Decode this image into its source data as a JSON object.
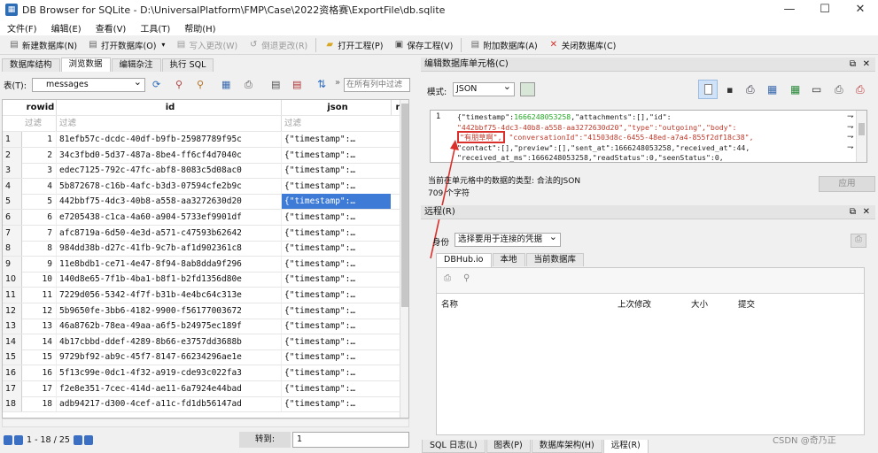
{
  "window": {
    "title": "DB Browser for SQLite - D:\\UniversalPlatform\\FMP\\Case\\2022资格赛\\ExportFile\\db.sqlite"
  },
  "menu": [
    "文件(F)",
    "编辑(E)",
    "查看(V)",
    "工具(T)",
    "帮助(H)"
  ],
  "toolbar": {
    "new_db": "新建数据库(N)",
    "open_db": "打开数据库(O)",
    "write_changes": "写入更改(W)",
    "revert_changes": "倒退更改(R)",
    "open_project": "打开工程(P)",
    "save_project": "保存工程(V)",
    "attach_db": "附加数据库(A)",
    "close_db": "关闭数据库(C)"
  },
  "left": {
    "tabs": [
      "数据库结构",
      "浏览数据",
      "编辑杂注",
      "执行 SQL"
    ],
    "table_label": "表(T):",
    "table_value": "messages",
    "filter_placeholder": "在所有列中过滤",
    "columns": [
      "rowid",
      "id",
      "json"
    ],
    "filter_text": "过滤",
    "rows": [
      {
        "n": "1",
        "rowid": "1",
        "id": "81efb57c-dcdc-40df-b9fb-25987789f95c",
        "json": "{\"timestamp\":…"
      },
      {
        "n": "2",
        "rowid": "2",
        "id": "34c3fbd0-5d37-487a-8be4-ff6cf4d7040c",
        "json": "{\"timestamp\":…"
      },
      {
        "n": "3",
        "rowid": "3",
        "id": "edec7125-792c-47fc-abf8-8083c5d08ac0",
        "json": "{\"timestamp\":…"
      },
      {
        "n": "4",
        "rowid": "4",
        "id": "5b872678-c16b-4afc-b3d3-07594cfe2b9c",
        "json": "{\"timestamp\":…"
      },
      {
        "n": "5",
        "rowid": "5",
        "id": "442bbf75-4dc3-40b8-a558-aa3272630d20",
        "json": "{\"timestamp\":…"
      },
      {
        "n": "6",
        "rowid": "6",
        "id": "e7205438-c1ca-4a60-a904-5733ef9901df",
        "json": "{\"timestamp\":…"
      },
      {
        "n": "7",
        "rowid": "7",
        "id": "afc8719a-6d50-4e3d-a571-c47593b62642",
        "json": "{\"timestamp\":…"
      },
      {
        "n": "8",
        "rowid": "8",
        "id": "984dd38b-d27c-41fb-9c7b-af1d902361c8",
        "json": "{\"timestamp\":…"
      },
      {
        "n": "9",
        "rowid": "9",
        "id": "11e8bdb1-ce71-4e47-8f94-8ab8dda9f296",
        "json": "{\"timestamp\":…"
      },
      {
        "n": "10",
        "rowid": "10",
        "id": "140d8e65-7f1b-4ba1-b8f1-b2fd1356d80e",
        "json": "{\"timestamp\":…"
      },
      {
        "n": "11",
        "rowid": "11",
        "id": "7229d056-5342-4f7f-b31b-4e4bc64c313e",
        "json": "{\"timestamp\":…"
      },
      {
        "n": "12",
        "rowid": "12",
        "id": "5b9650fe-3bb6-4182-9900-f56177003672",
        "json": "{\"timestamp\":…"
      },
      {
        "n": "13",
        "rowid": "13",
        "id": "46a8762b-78ea-49aa-a6f5-b24975ec189f",
        "json": "{\"timestamp\":…"
      },
      {
        "n": "14",
        "rowid": "14",
        "id": "4b17cbbd-ddef-4289-8b66-e3757dd3688b",
        "json": "{\"timestamp\":…"
      },
      {
        "n": "15",
        "rowid": "15",
        "id": "9729bf92-ab9c-45f7-8147-66234296ae1e",
        "json": "{\"timestamp\":…"
      },
      {
        "n": "16",
        "rowid": "16",
        "id": "5f13c99e-0dc1-4f32-a919-cde93c022fa3",
        "json": "{\"timestamp\":…"
      },
      {
        "n": "17",
        "rowid": "17",
        "id": "f2e8e351-7cec-414d-ae11-6a7924e44bad",
        "json": "{\"timestamp\":…"
      },
      {
        "n": "18",
        "rowid": "18",
        "id": "adb94217-d300-4cef-a11c-fd1db56147ad",
        "json": "{\"timestamp\":…"
      }
    ],
    "pager": "1 - 18 / 25",
    "goto_label": "转到:",
    "goto_value": "1"
  },
  "editcell": {
    "title": "编辑数据库单元格(C)",
    "mode_label": "模式:",
    "mode_value": "JSON",
    "line_no": "1",
    "json_lines": [
      "{\"timestamp\":1666248053258,\"attachments\":[],\"id\":",
      "\"442bbf75-4dc3-40b8-a558-aa3272630d20\",\"type\":\"outgoing\",\"body\":",
      "\"有朋草啊\",\"conversationId\":\"41503d8c-6455-48ed-a7a4-855f2df18c38\",",
      "\"contact\":[],\"preview\":[],\"sent_at\":1666248053258,\"received_at\":44,",
      "\"received_at_ms\":1666248053258,\"readStatus\":0,\"seenStatus\":0,"
    ],
    "type_info": "当前在单元格中的数据的类型: 合法的JSON",
    "size_info": "709 个字符",
    "apply": "应用",
    "highlight_color": "#d9302c"
  },
  "remote": {
    "title": "远程(R)",
    "identity_label": "身份",
    "identity_value": "选择要用于连接的凭据",
    "tabs": [
      "DBHub.io",
      "本地",
      "当前数据库"
    ],
    "columns": [
      "名称",
      "上次修改",
      "大小",
      "提交"
    ]
  },
  "bottom_tabs": [
    "SQL 日志(L)",
    "图表(P)",
    "数据库架构(H)",
    "远程(R)"
  ],
  "watermark": "CSDN @奇乃正"
}
